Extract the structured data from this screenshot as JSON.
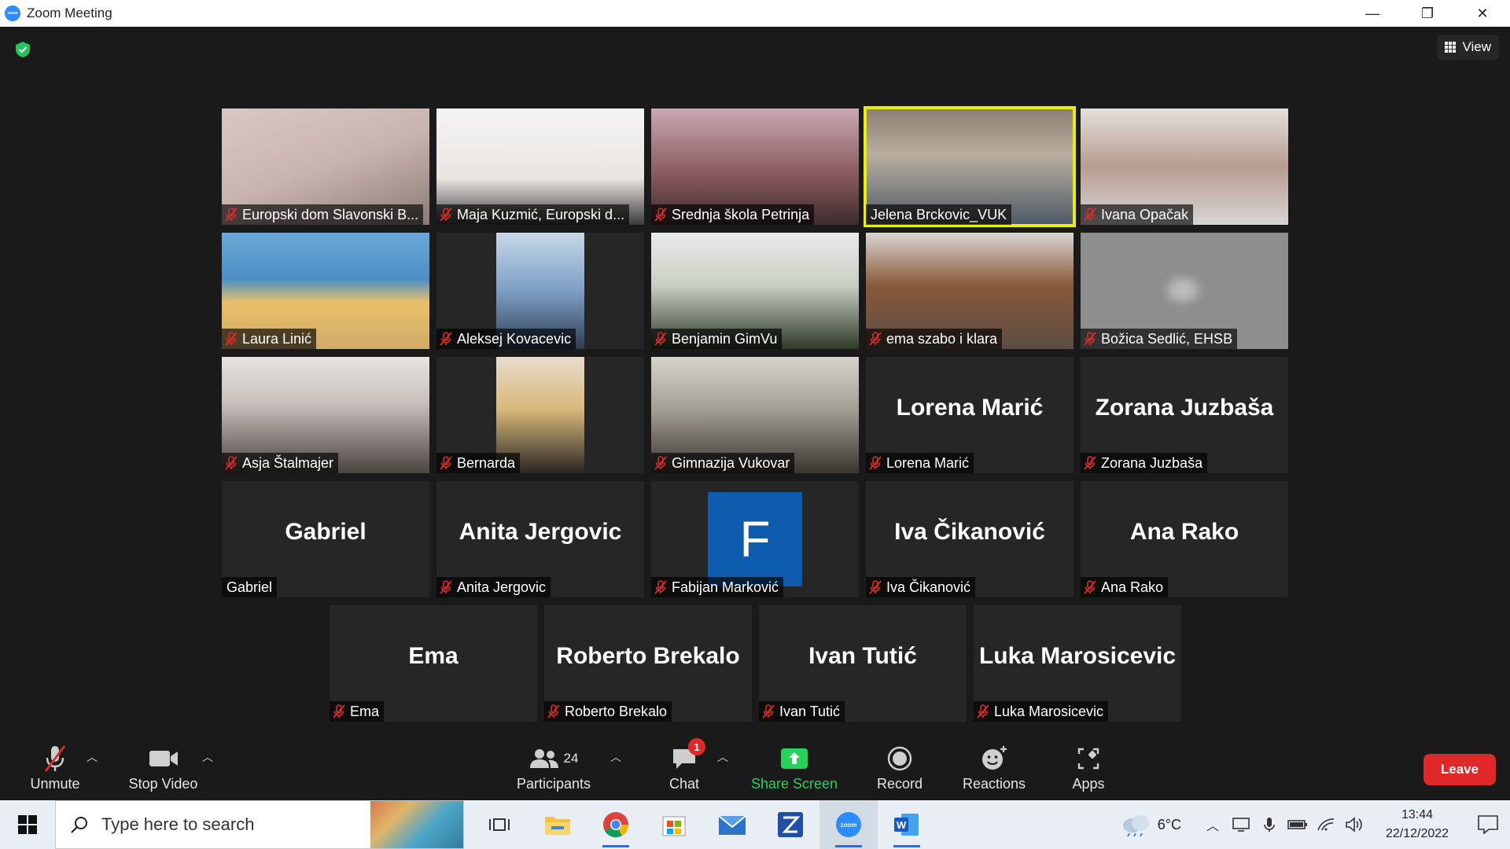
{
  "window": {
    "title": "Zoom Meeting",
    "minimize": "—",
    "restore": "❐",
    "close": "✕"
  },
  "meeting": {
    "view_label": "View",
    "participants": [
      {
        "label": "Europski dom Slavonski B...",
        "muted": true
      },
      {
        "label": "Maja Kuzmić, Europski d...",
        "muted": true
      },
      {
        "label": "Srednja škola Petrinja",
        "muted": true
      },
      {
        "label": "Jelena Brckovic_VUK",
        "muted": false,
        "active_speaker": true
      },
      {
        "label": "Ivana Opačak",
        "muted": true
      },
      {
        "label": "Laura Linić",
        "muted": true
      },
      {
        "label": "Aleksej Kovacevic",
        "muted": true
      },
      {
        "label": "Benjamin GimVu",
        "muted": true
      },
      {
        "label": "ema szabo i klara",
        "muted": true
      },
      {
        "label": "Božica Sedlić, EHSB",
        "muted": true
      },
      {
        "label": "Asja Štalmajer",
        "muted": true
      },
      {
        "label": "Bernarda",
        "muted": true
      },
      {
        "label": "Gimnazija Vukovar",
        "muted": true
      },
      {
        "label": "Lorena Marić",
        "display_name": "Lorena Marić",
        "muted": true
      },
      {
        "label": "Zorana Juzbaša",
        "display_name": "Zorana Juzbaša",
        "muted": true
      },
      {
        "label": "Gabriel",
        "display_name": "Gabriel",
        "muted": false
      },
      {
        "label": "Anita Jergovic",
        "display_name": "Anita Jergovic",
        "muted": true
      },
      {
        "label": "Fabijan Marković",
        "avatar_letter": "F",
        "muted": true
      },
      {
        "label": "Iva Čikanović",
        "display_name": "Iva Čikanović",
        "muted": true
      },
      {
        "label": "Ana Rako",
        "display_name": "Ana Rako",
        "muted": true
      },
      {
        "label": "Ema",
        "display_name": "Ema",
        "muted": true
      },
      {
        "label": "Roberto Brekalo",
        "display_name": "Roberto Brekalo",
        "muted": true
      },
      {
        "label": "Ivan Tutić",
        "display_name": "Ivan Tutić",
        "muted": true
      },
      {
        "label": "Luka Marosicevic",
        "display_name": "Luka Marosicevic",
        "muted": true
      }
    ]
  },
  "toolbar": {
    "unmute": "Unmute",
    "stop_video": "Stop Video",
    "participants_label": "Participants",
    "participants_count": "24",
    "chat": "Chat",
    "chat_badge": "1",
    "share_screen": "Share Screen",
    "record": "Record",
    "reactions": "Reactions",
    "apps": "Apps",
    "leave": "Leave"
  },
  "taskbar": {
    "search_placeholder": "Type here to search",
    "weather_temp": "6°C",
    "time": "13:44",
    "date": "22/12/2022"
  },
  "colors": {
    "zoom_blue": "#2d8cff",
    "share_green": "#24d35c",
    "leave_red": "#e02828",
    "active_speaker": "#e6f000",
    "mute_red": "#e02828"
  }
}
